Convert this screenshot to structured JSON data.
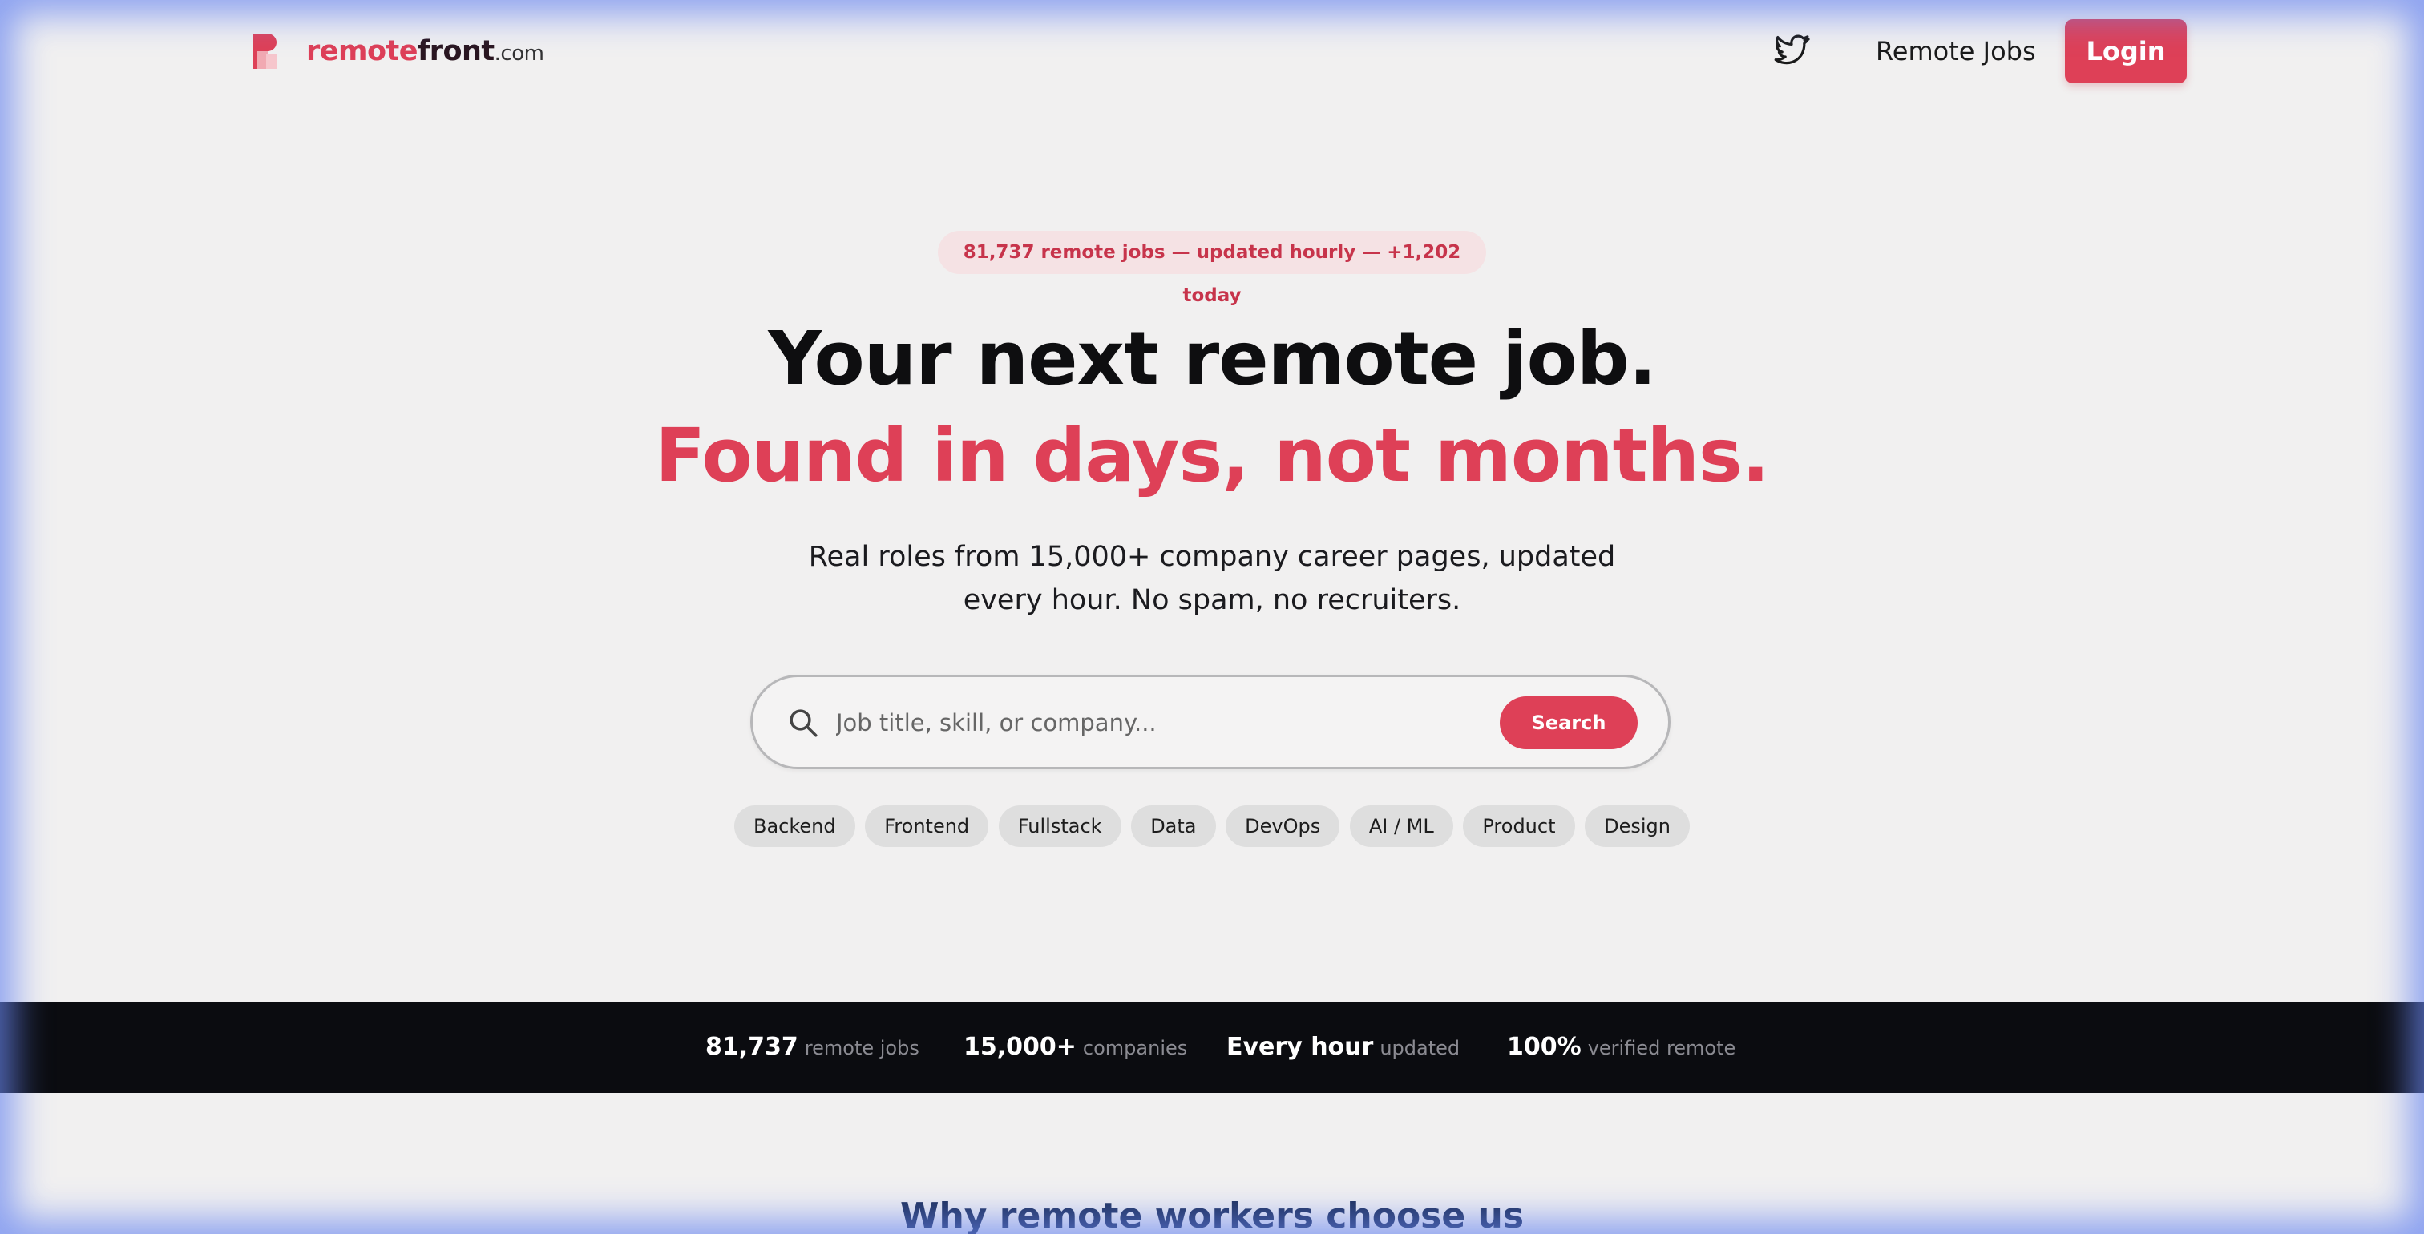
{
  "header": {
    "logo_brand_red": "remote",
    "logo_brand_dark": "front",
    "logo_tld": ".com",
    "nav_remote_jobs": "Remote Jobs",
    "login_label": "Login"
  },
  "hero": {
    "pill_text": "81,737 remote jobs — updated hourly — +1,202 today",
    "headline_line1": "Your next remote job.",
    "headline_line2": "Found in days, not months.",
    "subtitle": "Real roles from 15,000+ company career pages, updated every hour. No spam, no recruiters.",
    "search": {
      "placeholder": "Job title, skill, or company...",
      "value": "",
      "button_label": "Search"
    },
    "categories": [
      "Backend",
      "Frontend",
      "Fullstack",
      "Data",
      "DevOps",
      "AI / ML",
      "Product",
      "Design"
    ]
  },
  "stats": [
    {
      "value": "81,737",
      "label": "remote jobs"
    },
    {
      "value": "15,000+",
      "label": "companies"
    },
    {
      "value": "Every hour",
      "label": "updated"
    },
    {
      "value": "100%",
      "label": "verified remote"
    }
  ],
  "section": {
    "title": "Why remote workers choose us"
  },
  "colors": {
    "accent": "#de4057",
    "background": "#f1f0f0",
    "band": "#0b0c10",
    "section_title": "#1d2f5a"
  },
  "icons": {
    "twitter": "twitter-bird-icon",
    "search": "magnifier-search-icon"
  }
}
